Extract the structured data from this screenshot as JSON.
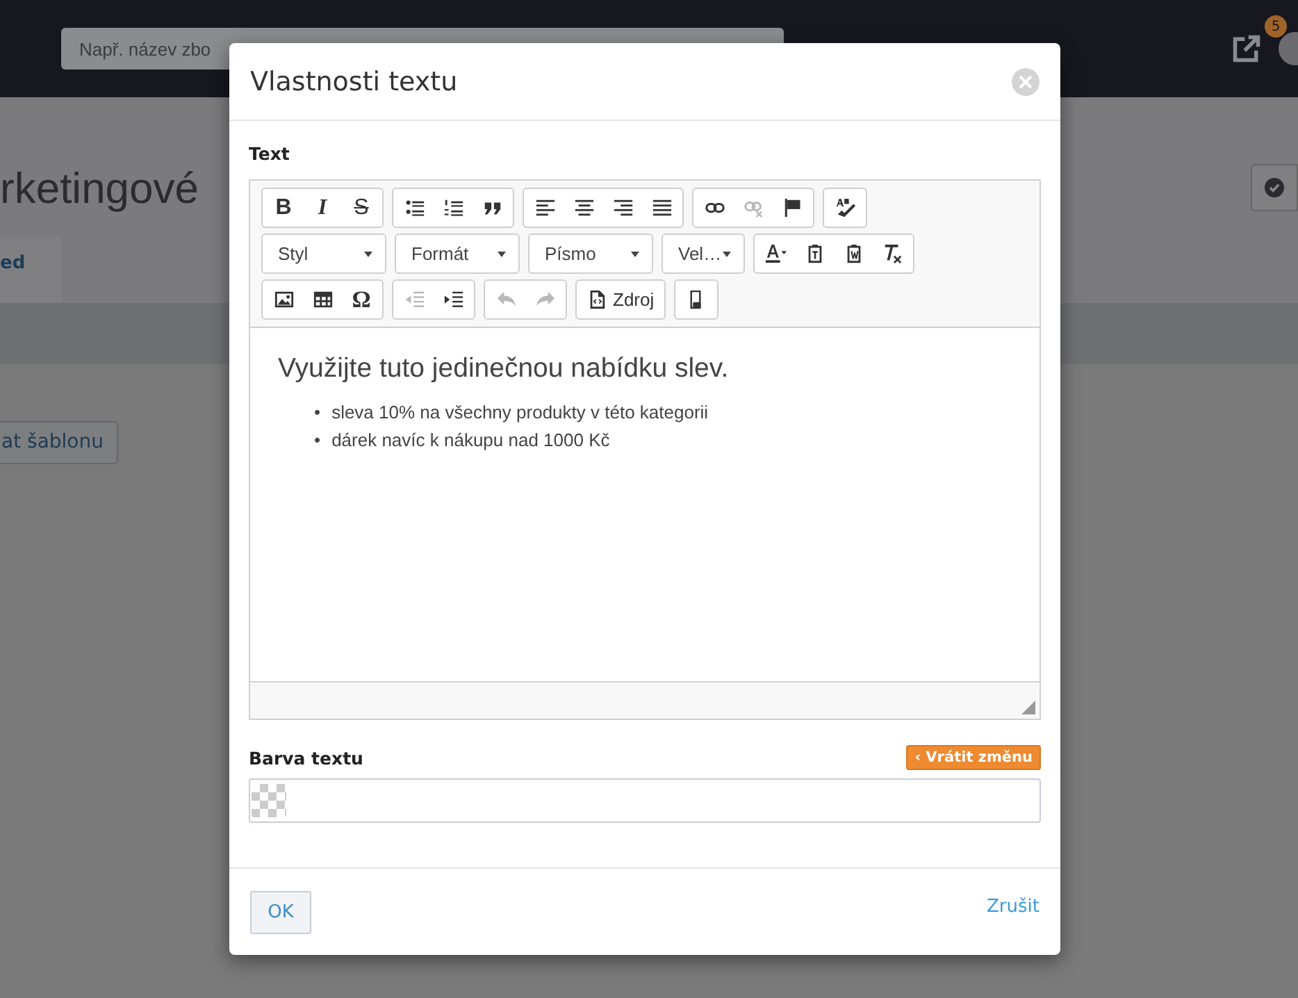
{
  "topbar": {
    "search": {
      "placeholder": "Např. název zbo"
    },
    "notifications": {
      "count": "5"
    }
  },
  "page": {
    "title": "rketingové",
    "tab": {
      "label": "ed",
      "selected": true
    },
    "template_button": "at šablonu"
  },
  "dialog": {
    "title": "Vlastnosti textu",
    "text_label": "Text",
    "toolbar_rows": [
      [
        [
          {
            "kind": "bold",
            "label": "B",
            "disabled": false
          },
          {
            "kind": "italic",
            "label": "I",
            "disabled": false
          },
          {
            "kind": "strike",
            "label": "S",
            "disabled": false
          }
        ],
        [
          {
            "kind": "bulleted-list",
            "disabled": false
          },
          {
            "kind": "numbered-list",
            "disabled": false
          },
          {
            "kind": "quote",
            "disabled": false
          }
        ],
        [
          {
            "kind": "align-left",
            "disabled": false
          },
          {
            "kind": "align-center",
            "disabled": false
          },
          {
            "kind": "align-right",
            "disabled": false
          },
          {
            "kind": "align-justify",
            "disabled": false
          }
        ],
        [
          {
            "kind": "link",
            "disabled": false
          },
          {
            "kind": "unlink",
            "disabled": true
          },
          {
            "kind": "flag",
            "disabled": false
          }
        ],
        [
          {
            "kind": "spellcheck",
            "disabled": false
          }
        ]
      ],
      [
        [
          {
            "kind": "dropdown",
            "label": "Styl",
            "disabled": false,
            "narrow": false
          }
        ],
        [
          {
            "kind": "dropdown",
            "label": "Formát",
            "disabled": false,
            "narrow": false
          }
        ],
        [
          {
            "kind": "dropdown",
            "label": "Písmo",
            "disabled": false,
            "narrow": false
          }
        ],
        [
          {
            "kind": "dropdown",
            "label": "Vel…",
            "disabled": false,
            "narrow": true
          }
        ],
        [
          {
            "kind": "text-color",
            "disabled": false
          },
          {
            "kind": "paste-text",
            "disabled": false
          },
          {
            "kind": "paste-word",
            "disabled": false
          },
          {
            "kind": "remove-format",
            "disabled": false
          }
        ]
      ],
      [
        [
          {
            "kind": "image",
            "disabled": false
          },
          {
            "kind": "table",
            "disabled": false
          },
          {
            "kind": "glyph",
            "label": "Ω",
            "disabled": false
          }
        ],
        [
          {
            "kind": "outdent",
            "disabled": true
          },
          {
            "kind": "indent",
            "disabled": false
          }
        ],
        [
          {
            "kind": "undo",
            "disabled": true
          },
          {
            "kind": "redo",
            "disabled": true
          }
        ],
        [
          {
            "kind": "source",
            "label": "Zdroj",
            "disabled": false
          }
        ],
        [
          {
            "kind": "templates",
            "disabled": false
          }
        ]
      ]
    ],
    "content": {
      "heading": "Využijte tuto jedinečnou nabídku slev.",
      "items": [
        {
          "marker": "•",
          "text": "sleva 10% na všechny produkty v této kategorii"
        },
        {
          "marker": "•",
          "text": "dárek navíc k nákupu nad 1000 Kč"
        }
      ]
    },
    "color_label": "Barva textu",
    "revert_button": "‹ Vrátit změnu",
    "ok_button": "OK",
    "cancel_link": "Zrušit"
  }
}
